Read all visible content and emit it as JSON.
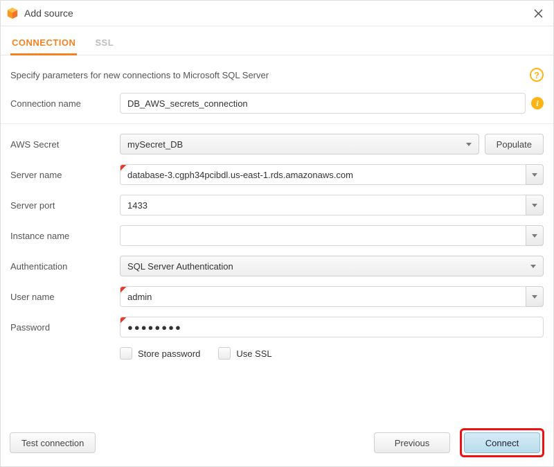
{
  "titlebar": {
    "title": "Add source"
  },
  "tabs": {
    "connection": "CONNECTION",
    "ssl": "SSL"
  },
  "intro": "Specify parameters for new connections to Microsoft SQL Server",
  "labels": {
    "connection_name": "Connection name",
    "aws_secret": "AWS Secret",
    "server_name": "Server name",
    "server_port": "Server port",
    "instance_name": "Instance name",
    "authentication": "Authentication",
    "user_name": "User name",
    "password": "Password"
  },
  "values": {
    "connection_name": "DB_AWS_secrets_connection",
    "aws_secret": "mySecret_DB",
    "server_name": "database-3.cgph34pcibdl.us-east-1.rds.amazonaws.com",
    "server_port": "1433",
    "instance_name": "",
    "authentication": "SQL Server Authentication",
    "user_name": "admin",
    "password_display": "●●●●●●●●"
  },
  "buttons": {
    "populate": "Populate",
    "test_connection": "Test connection",
    "previous": "Previous",
    "connect": "Connect"
  },
  "checkboxes": {
    "store_password": "Store password",
    "use_ssl": "Use SSL"
  }
}
